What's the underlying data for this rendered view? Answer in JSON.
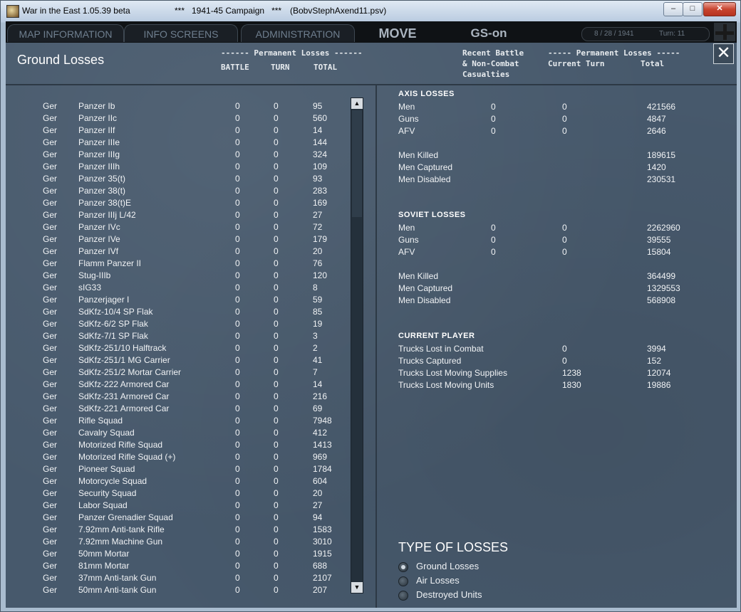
{
  "window": {
    "title": "War in the East 1.05.39 beta",
    "title_campaign": "***   1941-45 Campaign   ***",
    "title_file": "(BobvStephAxend11.psv)",
    "min_label": "–",
    "max_label": "□",
    "close_label": "✕"
  },
  "nav": {
    "tabs": [
      "MAP INFORMATION",
      "INFO SCREENS",
      "ADMINISTRATION"
    ],
    "mode": "MOVE",
    "gs": "GS-on",
    "date": "8 / 28 / 1941",
    "turn": "Turn: 11"
  },
  "header": {
    "title": "Ground Losses",
    "perm_losses_left": "------ Permanent Losses ------",
    "col_battle": "BATTLE",
    "col_turn": "TURN",
    "col_total": "TOTAL",
    "recent_1": "Recent Battle",
    "recent_2": "& Non-Combat",
    "recent_3": "Casualties",
    "perm_losses_right": "----- Permanent Losses -----",
    "col_current_turn": "Current Turn",
    "col_total_right": "Total",
    "close_symbol": "✕"
  },
  "units": [
    {
      "nation": "Ger",
      "name": "Panzer Ib",
      "battle": "0",
      "turn": "0",
      "total": "95"
    },
    {
      "nation": "Ger",
      "name": "Panzer IIc",
      "battle": "0",
      "turn": "0",
      "total": "560"
    },
    {
      "nation": "Ger",
      "name": "Panzer IIf",
      "battle": "0",
      "turn": "0",
      "total": "14"
    },
    {
      "nation": "Ger",
      "name": "Panzer IIIe",
      "battle": "0",
      "turn": "0",
      "total": "144"
    },
    {
      "nation": "Ger",
      "name": "Panzer IIIg",
      "battle": "0",
      "turn": "0",
      "total": "324"
    },
    {
      "nation": "Ger",
      "name": "Panzer IIIh",
      "battle": "0",
      "turn": "0",
      "total": "109"
    },
    {
      "nation": "Ger",
      "name": "Panzer 35(t)",
      "battle": "0",
      "turn": "0",
      "total": "93"
    },
    {
      "nation": "Ger",
      "name": "Panzer 38(t)",
      "battle": "0",
      "turn": "0",
      "total": "283"
    },
    {
      "nation": "Ger",
      "name": "Panzer 38(t)E",
      "battle": "0",
      "turn": "0",
      "total": "169"
    },
    {
      "nation": "Ger",
      "name": "Panzer IIIj L/42",
      "battle": "0",
      "turn": "0",
      "total": "27"
    },
    {
      "nation": "Ger",
      "name": "Panzer IVc",
      "battle": "0",
      "turn": "0",
      "total": "72"
    },
    {
      "nation": "Ger",
      "name": "Panzer IVe",
      "battle": "0",
      "turn": "0",
      "total": "179"
    },
    {
      "nation": "Ger",
      "name": "Panzer IVf",
      "battle": "0",
      "turn": "0",
      "total": "20"
    },
    {
      "nation": "Ger",
      "name": "Flamm Panzer II",
      "battle": "0",
      "turn": "0",
      "total": "76"
    },
    {
      "nation": "Ger",
      "name": "Stug-IIIb",
      "battle": "0",
      "turn": "0",
      "total": "120"
    },
    {
      "nation": "Ger",
      "name": "sIG33",
      "battle": "0",
      "turn": "0",
      "total": "8"
    },
    {
      "nation": "Ger",
      "name": "Panzerjager I",
      "battle": "0",
      "turn": "0",
      "total": "59"
    },
    {
      "nation": "Ger",
      "name": "SdKfz-10/4 SP Flak",
      "battle": "0",
      "turn": "0",
      "total": "85"
    },
    {
      "nation": "Ger",
      "name": "SdKfz-6/2 SP Flak",
      "battle": "0",
      "turn": "0",
      "total": "19"
    },
    {
      "nation": "Ger",
      "name": "SdKfz-7/1 SP Flak",
      "battle": "0",
      "turn": "0",
      "total": "3"
    },
    {
      "nation": "Ger",
      "name": "SdKfz-251/10 Halftrack",
      "battle": "0",
      "turn": "0",
      "total": "2"
    },
    {
      "nation": "Ger",
      "name": "SdKfz-251/1 MG Carrier",
      "battle": "0",
      "turn": "0",
      "total": "41"
    },
    {
      "nation": "Ger",
      "name": "SdKfz-251/2 Mortar Carrier",
      "battle": "0",
      "turn": "0",
      "total": "7"
    },
    {
      "nation": "Ger",
      "name": "SdKfz-222 Armored Car",
      "battle": "0",
      "turn": "0",
      "total": "14"
    },
    {
      "nation": "Ger",
      "name": "SdKfz-231 Armored Car",
      "battle": "0",
      "turn": "0",
      "total": "216"
    },
    {
      "nation": "Ger",
      "name": "SdKfz-221 Armored Car",
      "battle": "0",
      "turn": "0",
      "total": "69"
    },
    {
      "nation": "Ger",
      "name": "Rifle Squad",
      "battle": "0",
      "turn": "0",
      "total": "7948"
    },
    {
      "nation": "Ger",
      "name": "Cavalry Squad",
      "battle": "0",
      "turn": "0",
      "total": "412"
    },
    {
      "nation": "Ger",
      "name": "Motorized Rifle Squad",
      "battle": "0",
      "turn": "0",
      "total": "1413"
    },
    {
      "nation": "Ger",
      "name": "Motorized Rifle Squad (+)",
      "battle": "0",
      "turn": "0",
      "total": "969"
    },
    {
      "nation": "Ger",
      "name": "Pioneer Squad",
      "battle": "0",
      "turn": "0",
      "total": "1784"
    },
    {
      "nation": "Ger",
      "name": "Motorcycle Squad",
      "battle": "0",
      "turn": "0",
      "total": "604"
    },
    {
      "nation": "Ger",
      "name": "Security Squad",
      "battle": "0",
      "turn": "0",
      "total": "20"
    },
    {
      "nation": "Ger",
      "name": "Labor Squad",
      "battle": "0",
      "turn": "0",
      "total": "27"
    },
    {
      "nation": "Ger",
      "name": "Panzer Grenadier Squad",
      "battle": "0",
      "turn": "0",
      "total": "94"
    },
    {
      "nation": "Ger",
      "name": "7.92mm Anti-tank Rifle",
      "battle": "0",
      "turn": "0",
      "total": "1583"
    },
    {
      "nation": "Ger",
      "name": "7.92mm Machine Gun",
      "battle": "0",
      "turn": "0",
      "total": "3010"
    },
    {
      "nation": "Ger",
      "name": "50mm Mortar",
      "battle": "0",
      "turn": "0",
      "total": "1915"
    },
    {
      "nation": "Ger",
      "name": "81mm Mortar",
      "battle": "0",
      "turn": "0",
      "total": "688"
    },
    {
      "nation": "Ger",
      "name": "37mm Anti-tank Gun",
      "battle": "0",
      "turn": "0",
      "total": "2107"
    },
    {
      "nation": "Ger",
      "name": "50mm Anti-tank Gun",
      "battle": "0",
      "turn": "0",
      "total": "207"
    }
  ],
  "scroll": {
    "up": "▲",
    "down": "▼"
  },
  "axis": {
    "title": "AXIS LOSSES",
    "rows": [
      {
        "label": "Men",
        "recent": "0",
        "turn": "0",
        "total": "421566"
      },
      {
        "label": "Guns",
        "recent": "0",
        "turn": "0",
        "total": "4847"
      },
      {
        "label": "AFV",
        "recent": "0",
        "turn": "0",
        "total": "2646"
      }
    ],
    "detail": [
      {
        "label": "Men Killed",
        "total": "189615"
      },
      {
        "label": "Men Captured",
        "total": "1420"
      },
      {
        "label": "Men Disabled",
        "total": "230531"
      }
    ]
  },
  "soviet": {
    "title": "SOVIET LOSSES",
    "rows": [
      {
        "label": "Men",
        "recent": "0",
        "turn": "0",
        "total": "2262960"
      },
      {
        "label": "Guns",
        "recent": "0",
        "turn": "0",
        "total": "39555"
      },
      {
        "label": "AFV",
        "recent": "0",
        "turn": "0",
        "total": "15804"
      }
    ],
    "detail": [
      {
        "label": "Men Killed",
        "total": "364499"
      },
      {
        "label": "Men Captured",
        "total": "1329553"
      },
      {
        "label": "Men Disabled",
        "total": "568908"
      }
    ]
  },
  "player": {
    "title": "CURRENT PLAYER",
    "rows": [
      {
        "label": "Trucks Lost in Combat",
        "turn": "0",
        "total": "3994"
      },
      {
        "label": "Trucks Captured",
        "turn": "0",
        "total": "152"
      },
      {
        "label": "Trucks Lost Moving Supplies",
        "turn": "1238",
        "total": "12074"
      },
      {
        "label": "Trucks Lost Moving Units",
        "turn": "1830",
        "total": "19886"
      }
    ]
  },
  "types": {
    "title": "TYPE OF LOSSES",
    "options": [
      {
        "label": "Ground Losses",
        "selected": true
      },
      {
        "label": "Air Losses",
        "selected": false
      },
      {
        "label": "Destroyed Units",
        "selected": false
      }
    ]
  }
}
